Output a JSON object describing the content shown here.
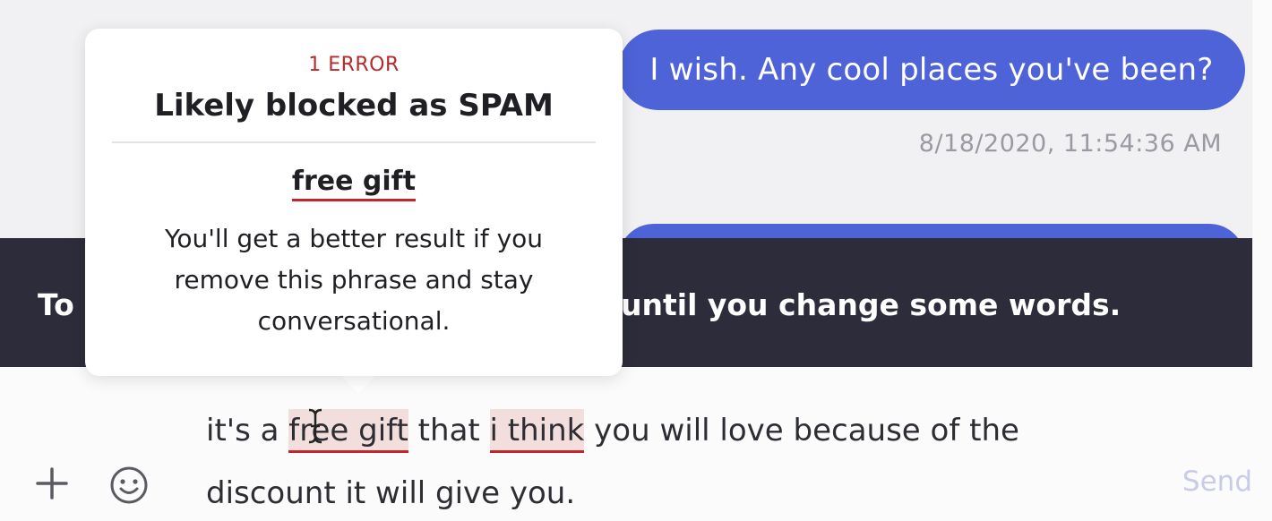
{
  "chat": {
    "outgoing_message": "I wish. Any cool places you've been?",
    "timestamp": "8/18/2020, 11:54:36 AM"
  },
  "warning": {
    "lead": "To",
    "tail": "until you change some words."
  },
  "popover": {
    "error_count": "1 ERROR",
    "title": "Likely blocked as SPAM",
    "phrase": "free gift",
    "advice": "You'll get a better result if you remove this phrase and stay conversational."
  },
  "composer": {
    "seg1": "it's a ",
    "flag1": "free gift",
    "seg2": " that ",
    "flag2": "i think",
    "seg3": " you will love because of the discount it will give you.",
    "send_label": "Send"
  },
  "icons": {
    "add": "plus-icon",
    "emoji": "smile-icon",
    "cursor": "text-cursor-icon"
  },
  "colors": {
    "bubble": "#4e63d8",
    "banner": "#2d2c3a",
    "error": "#c0262a",
    "send_disabled": "#c8cce6"
  }
}
